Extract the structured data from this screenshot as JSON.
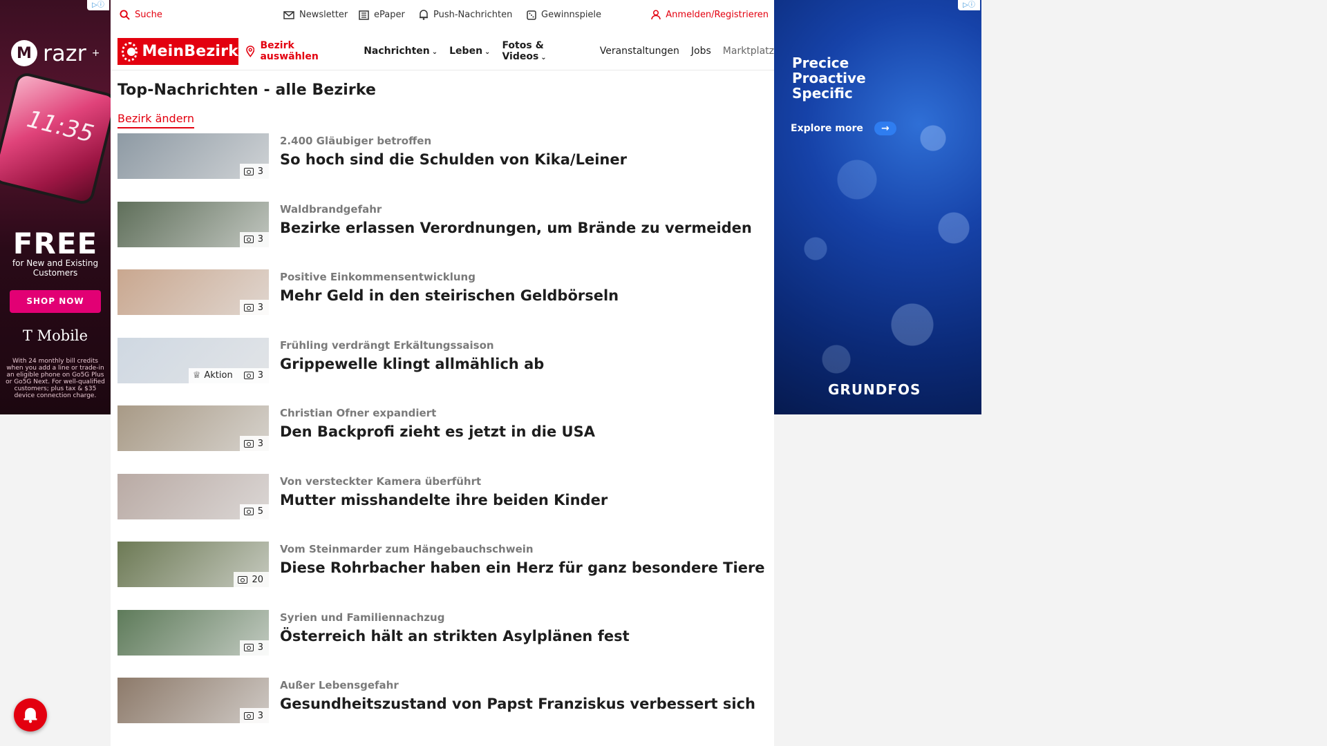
{
  "ads": {
    "left": {
      "brand": "razr",
      "brand_sup": "+",
      "phone_time": "11:35",
      "headline": "FREE",
      "subline": "for New and Existing Customers",
      "cta": "SHOP NOW",
      "sponsor": "T Mobile",
      "fineprint": "With 24 monthly bill credits when you add a line or trade-in an eligible phone on Go5G Plus or Go5G Next. For well-qualified customers; plus tax & $35 device connection charge."
    },
    "right": {
      "tagline_1": "Precice",
      "tagline_2": "Proactive",
      "tagline_3": "Specific",
      "cta": "Explore more",
      "logo": "GRUNDFOS"
    }
  },
  "topbar": {
    "search": "Suche",
    "newsletter": "Newsletter",
    "epaper": "ePaper",
    "push": "Push-Nachrichten",
    "gewinnspiele": "Gewinnspiele",
    "login": "Anmelden/Registrieren"
  },
  "nav": {
    "logo": "MeinBezirk",
    "bezirk": "Bezirk auswählen",
    "items": [
      {
        "label": "Nachrichten",
        "chevron": true
      },
      {
        "label": "Leben",
        "chevron": true
      },
      {
        "label": "Fotos & Videos",
        "chevron": true
      },
      {
        "label": "Veranstaltungen",
        "chevron": false
      },
      {
        "label": "Jobs",
        "chevron": false
      },
      {
        "label": "Marktplatz",
        "chevron": false
      }
    ]
  },
  "section": {
    "title": "Top-Nachrichten - alle Bezirke",
    "change": "Bezirk ändern"
  },
  "articles": [
    {
      "kicker": "2.400 Gläubiger betroffen",
      "headline": "So hoch sind die Schulden von Kika/Leiner",
      "photos": "3",
      "aktion": "",
      "thumb": "#8e9aa4"
    },
    {
      "kicker": "Waldbrandgefahr",
      "headline": "Bezirke erlassen Verordnungen, um Brände zu vermeiden",
      "photos": "3",
      "aktion": "",
      "thumb": "#5f6f5a"
    },
    {
      "kicker": "Positive Einkommensentwicklung",
      "headline": "Mehr Geld in den steirischen Geldbörseln",
      "photos": "3",
      "aktion": "",
      "thumb": "#c9a78f"
    },
    {
      "kicker": "Frühling verdrängt Erkältungssaison",
      "headline": "Grippewelle klingt allmählich ab",
      "photos": "3",
      "aktion": "Aktion",
      "thumb": "#cfd8e2"
    },
    {
      "kicker": "Christian Ofner expandiert",
      "headline": "Den Backprofi zieht es jetzt in die USA",
      "photos": "3",
      "aktion": "",
      "thumb": "#a89a86"
    },
    {
      "kicker": "Von versteckter Kamera überführt",
      "headline": "Mutter misshandelte ihre beiden Kinder",
      "photos": "5",
      "aktion": "",
      "thumb": "#b9aaa4"
    },
    {
      "kicker": "Vom Steinmarder zum Hängebauchschwein",
      "headline": "Diese Rohrbacher haben ein Herz für ganz besondere Tiere",
      "photos": "20",
      "aktion": "",
      "thumb": "#6d7a55"
    },
    {
      "kicker": "Syrien und Familiennachzug",
      "headline": "Österreich hält an strikten Asylplänen fest",
      "photos": "3",
      "aktion": "",
      "thumb": "#5e7b5a"
    },
    {
      "kicker": "Außer Lebensgefahr",
      "headline": "Gesundheitszustand von Papst Franziskus verbessert sich",
      "photos": "3",
      "aktion": "",
      "thumb": "#8d7a6a"
    }
  ],
  "colors": {
    "brand_red": "#e3000f",
    "kicker_gray": "#7a7a7a"
  }
}
